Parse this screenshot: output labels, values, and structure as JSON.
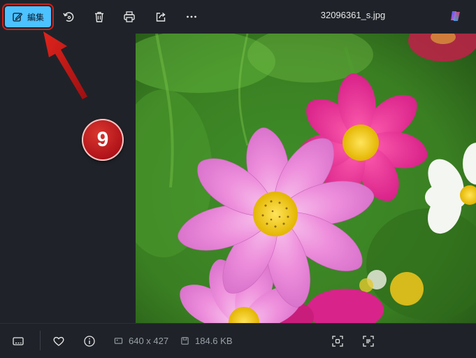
{
  "toolbar": {
    "edit_label": "編集",
    "filename": "32096361_s.jpg",
    "icons": [
      "edit-icon",
      "rotate-icon",
      "delete-icon",
      "print-icon",
      "share-icon",
      "more-icon",
      "copilot-icon"
    ]
  },
  "annotation": {
    "step_number": "9",
    "color": "#c8171d"
  },
  "status": {
    "dimensions": "640 x 427",
    "file_size": "184.6 KB"
  },
  "colors": {
    "accent": "#4cc2ff",
    "background": "#1f2329"
  }
}
